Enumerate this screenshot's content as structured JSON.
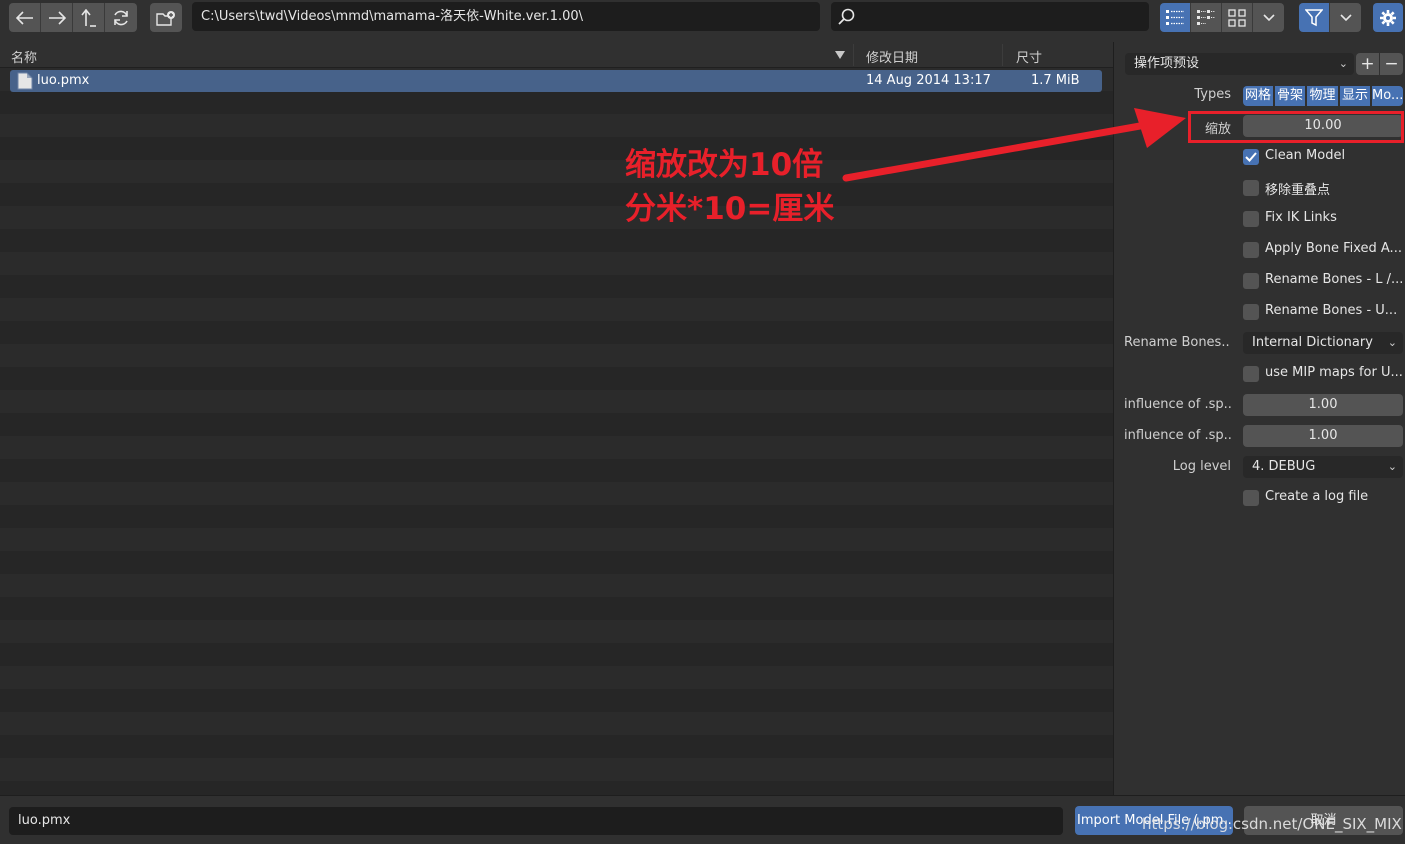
{
  "toolbar": {
    "path": "C:\\Users\\twd\\Videos\\mmd\\mamama-洛天依-White.ver.1.00\\",
    "search_value": "",
    "nav_icons": [
      "arrow-left-icon",
      "arrow-right-icon",
      "parent-directory-icon",
      "refresh-icon"
    ],
    "view_icons": [
      "vertical-list-icon",
      "horizontal-list-icon",
      "thumbnail-grid-icon"
    ]
  },
  "columns": {
    "name": "名称",
    "date": "修改日期",
    "size": "尺寸"
  },
  "files": [
    {
      "name": "luo.pmx",
      "date": "14 Aug 2014 13:17",
      "size": "1.7 MiB",
      "selected": true
    }
  ],
  "sidebar": {
    "preset_label": "操作项预设",
    "types_label": "Types",
    "types": [
      "网格",
      "骨架",
      "物理",
      "显示",
      "Mo..."
    ],
    "scale_label": "缩放",
    "scale_value": "10.00",
    "checkboxes": [
      {
        "label": "Clean Model",
        "checked": true
      },
      {
        "label": "移除重叠点",
        "checked": false
      },
      {
        "label": "Fix IK Links",
        "checked": false
      },
      {
        "label": "Apply Bone Fixed A...",
        "checked": false
      },
      {
        "label": "Rename Bones - L /...",
        "checked": false
      },
      {
        "label": "Rename Bones - U...",
        "checked": false
      }
    ],
    "rename_label": "Rename Bones...",
    "rename_value": "Internal Dictionary",
    "mip_label": "use MIP maps for U...",
    "influence1_label": "influence of .sp...",
    "influence1_value": "1.00",
    "influence2_label": "influence of .sp...",
    "influence2_value": "1.00",
    "loglevel_label": "Log level",
    "loglevel_value": "4. DEBUG",
    "logfile_label": "Create a log file"
  },
  "bottom": {
    "filename": "luo.pmx",
    "import_label": "Import Model File (.pm...",
    "cancel_label": "取消"
  },
  "annotation": {
    "line1": "缩放改为10倍",
    "line2": "分米*10=厘米"
  },
  "watermark": "https://blog.csdn.net/ONE_SIX_MIX",
  "colors": {
    "accent": "#4772b3",
    "selected_row": "#47628a",
    "annotation": "#e8202a"
  }
}
